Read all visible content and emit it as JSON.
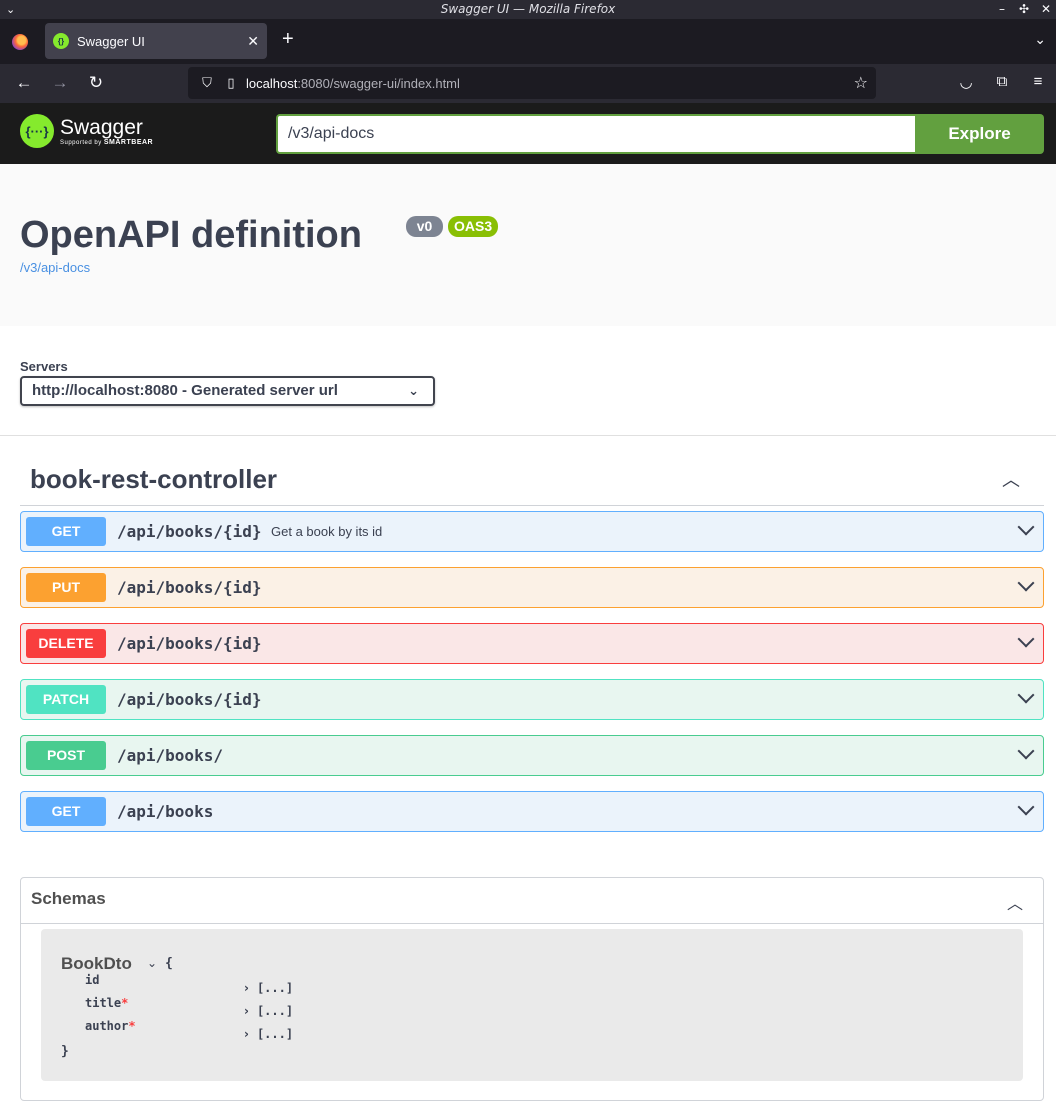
{
  "window": {
    "title": "Swagger UI — Mozilla Firefox"
  },
  "browser": {
    "tab_title": "Swagger UI",
    "url_host": "localhost",
    "url_path": ":8080/swagger-ui/index.html"
  },
  "topbar": {
    "logo_name": "Swagger",
    "logo_sub": "Supported by",
    "logo_brand": "SMARTBEAR",
    "api_url": "/v3/api-docs",
    "explore_label": "Explore"
  },
  "info": {
    "title": "OpenAPI definition",
    "version": "v0",
    "oas": "OAS3",
    "spec_link": "/v3/api-docs"
  },
  "servers": {
    "label": "Servers",
    "selected": "http://localhost:8080 - Generated server url"
  },
  "tag": {
    "name": "book-rest-controller",
    "operations": [
      {
        "method": "GET",
        "path": "/api/books/{id}",
        "summary": "Get a book by its id"
      },
      {
        "method": "PUT",
        "path": "/api/books/{id}",
        "summary": ""
      },
      {
        "method": "DELETE",
        "path": "/api/books/{id}",
        "summary": ""
      },
      {
        "method": "PATCH",
        "path": "/api/books/{id}",
        "summary": ""
      },
      {
        "method": "POST",
        "path": "/api/books/",
        "summary": ""
      },
      {
        "method": "GET",
        "path": "/api/books",
        "summary": ""
      }
    ]
  },
  "schemas": {
    "title": "Schemas",
    "model": {
      "name": "BookDto",
      "open_brace": "{",
      "close_brace": "}",
      "properties": [
        {
          "name": "id",
          "required": false,
          "value": "[...]"
        },
        {
          "name": "title",
          "required": true,
          "value": "[...]"
        },
        {
          "name": "author",
          "required": true,
          "value": "[...]"
        }
      ]
    }
  }
}
